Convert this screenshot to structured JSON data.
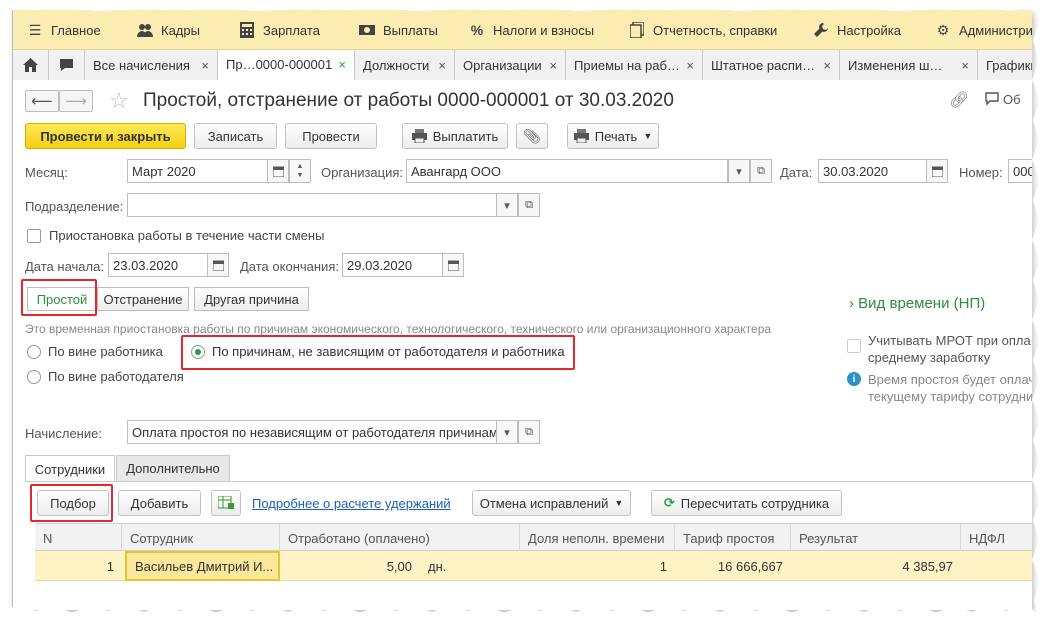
{
  "menu": {
    "items": [
      {
        "label": "Главное",
        "icon": "menu-hamburger-icon"
      },
      {
        "label": "Кадры",
        "icon": "people-icon"
      },
      {
        "label": "Зарплата",
        "icon": "calculator-icon"
      },
      {
        "label": "Выплаты",
        "icon": "cash-icon"
      },
      {
        "label": "Налоги и взносы",
        "icon": "percent-icon"
      },
      {
        "label": "Отчетность, справки",
        "icon": "documents-icon"
      },
      {
        "label": "Настройка",
        "icon": "wrench-icon"
      },
      {
        "label": "Администри",
        "icon": "gear-icon"
      }
    ]
  },
  "tabs": [
    {
      "label": "Все начисления",
      "close": "×"
    },
    {
      "label": "Пр…0000-000001",
      "close": "×"
    },
    {
      "label": "Должности",
      "close": "×"
    },
    {
      "label": "Организации",
      "close": "×"
    },
    {
      "label": "Приемы на раб…",
      "close": "×"
    },
    {
      "label": "Штатное распи…",
      "close": "×"
    },
    {
      "label": "Изменения ш…",
      "close": "×"
    },
    {
      "label": "Графики",
      "close": ""
    }
  ],
  "header": {
    "title": "Простой, отстранение от работы 0000-000001 от 30.03.2020",
    "right_label": "Об"
  },
  "toolbar": {
    "post_close": "Провести и закрыть",
    "save": "Записать",
    "post": "Провести",
    "pay": "Выплатить",
    "print": "Печать"
  },
  "form": {
    "month_label": "Месяц:",
    "month_value": "Март 2020",
    "org_label": "Организация:",
    "org_value": "Авангард ООО",
    "date_label": "Дата:",
    "date_value": "30.03.2020",
    "number_label": "Номер:",
    "number_value": "000",
    "division_label": "Подразделение:",
    "division_value": "",
    "partial_shift_label": "Приостановка работы в течение части смены",
    "start_label": "Дата начала:",
    "start_value": "23.03.2020",
    "end_label": "Дата окончания:",
    "end_value": "29.03.2020"
  },
  "segments": [
    "Простой",
    "Отстранение",
    "Другая причина"
  ],
  "hint": "Это временная приостановка работы по причинам экономического, технологического, технического или организационного характера",
  "radios": [
    {
      "label": "По вине работника",
      "checked": false
    },
    {
      "label": "По причинам, не зависящим от работодателя и работника",
      "checked": true
    },
    {
      "label": "По вине работодателя",
      "checked": false
    }
  ],
  "side": {
    "time_kind": "Вид времени (НП)",
    "mrot_line1": "Учитывать МРОТ при опла",
    "mrot_line2": "среднему заработку",
    "info_line1": "Время простоя будет оплач",
    "info_line2": "текущему тарифу сотрудни"
  },
  "accrual": {
    "label": "Начисление:",
    "value": "Оплата простоя по независящим от работодателя причинам"
  },
  "lower_tabs": [
    "Сотрудники",
    "Дополнительно"
  ],
  "table_toolbar": {
    "pick": "Подбор",
    "add": "Добавить",
    "details_link": "Подробнее о расчете удержаний",
    "cancel_fixes": "Отмена исправлений",
    "recalc": "Пересчитать сотрудника"
  },
  "table": {
    "columns": [
      "N",
      "Сотрудник",
      "Отработано (оплачено)",
      "Доля неполн. времени",
      "Тариф простоя",
      "Результат",
      "НДФЛ"
    ],
    "rows": [
      {
        "n": "1",
        "employee": "Васильев Дмитрий И...",
        "worked": "5,00",
        "unit": "дн.",
        "share": "1",
        "tariff": "16 666,667",
        "result": "4 385,97",
        "ndfl": ""
      }
    ]
  },
  "colors": {
    "accent_green": "#2a8f3a",
    "primary_yellow": "#f4cf11",
    "highlight_red": "#e0282e",
    "menu_bg": "#fbedb1"
  }
}
